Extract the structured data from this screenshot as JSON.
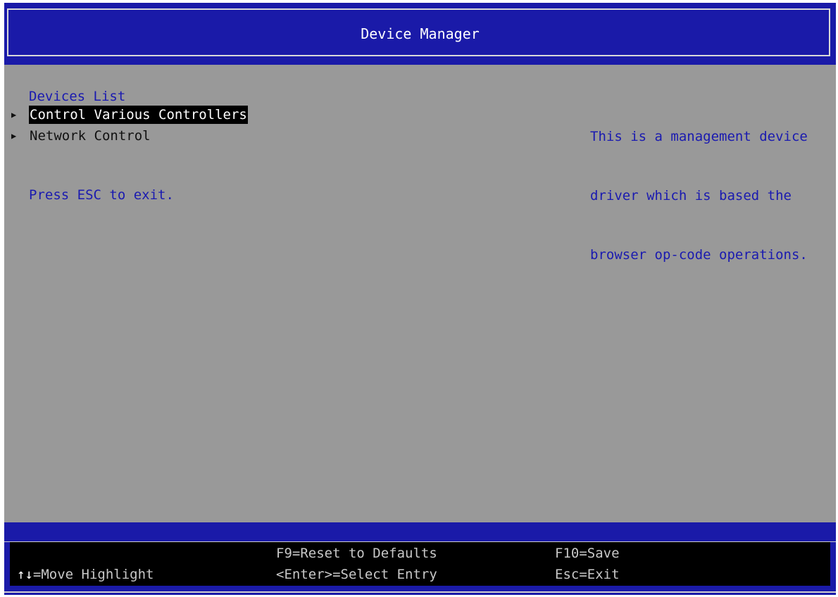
{
  "header": {
    "title": "Device Manager"
  },
  "main": {
    "section_title": "Devices List",
    "items": [
      {
        "label": "Control Various Controllers",
        "selected": true
      },
      {
        "label": "Network Control",
        "selected": false
      }
    ],
    "exit_hint": "Press ESC to exit."
  },
  "help": {
    "lines": [
      "This is a management device",
      "driver which is based the",
      "browser op-code operations."
    ]
  },
  "footer": {
    "move_arrows": "↑↓",
    "move_label": "=Move Highlight",
    "reset": "F9=Reset to Defaults",
    "select": "<Enter>=Select Entry",
    "save": "F10=Save",
    "exit": "Esc=Exit"
  },
  "colors": {
    "header_bg": "#1a1aa8",
    "body_bg": "#999999",
    "accent_text": "#1a1ab0",
    "footer_bg": "#000000"
  },
  "icons": {
    "submenu": "triangle-right-icon"
  }
}
